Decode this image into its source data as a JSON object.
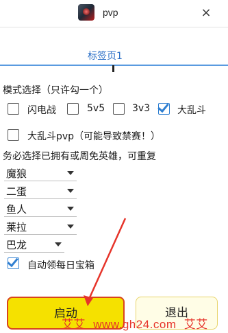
{
  "window": {
    "title": "pvp",
    "close_icon": "×"
  },
  "tab": {
    "label": "标签页1"
  },
  "mode": {
    "heading": "模式选择（只许勾一个）",
    "options": [
      {
        "label": "闪电战",
        "checked": false
      },
      {
        "label": "5v5",
        "checked": false
      },
      {
        "label": "3v3",
        "checked": false
      },
      {
        "label": "大乱斗",
        "checked": true
      },
      {
        "label": "大乱斗pvp（可能导致禁赛！）",
        "checked": false
      }
    ]
  },
  "heroes": {
    "notice": "务必选择已拥有或周免英雄，可重复",
    "selects": [
      "魔狼",
      "二蛋",
      "鱼人",
      "莱拉",
      "巴龙"
    ]
  },
  "daily_chest": {
    "label": "自动领每日宝箱",
    "checked": true
  },
  "buttons": {
    "start": "启动",
    "exit": "退出"
  },
  "watermark": {
    "text": "www.gh24.com",
    "prefix": "艾艾",
    "suffix": "艾艾"
  },
  "colors": {
    "tab_accent": "#2b6fc7",
    "checkbox_accent": "#2f7fd1",
    "start_button": "#f5e100",
    "annotation_red": "#e6342a"
  }
}
